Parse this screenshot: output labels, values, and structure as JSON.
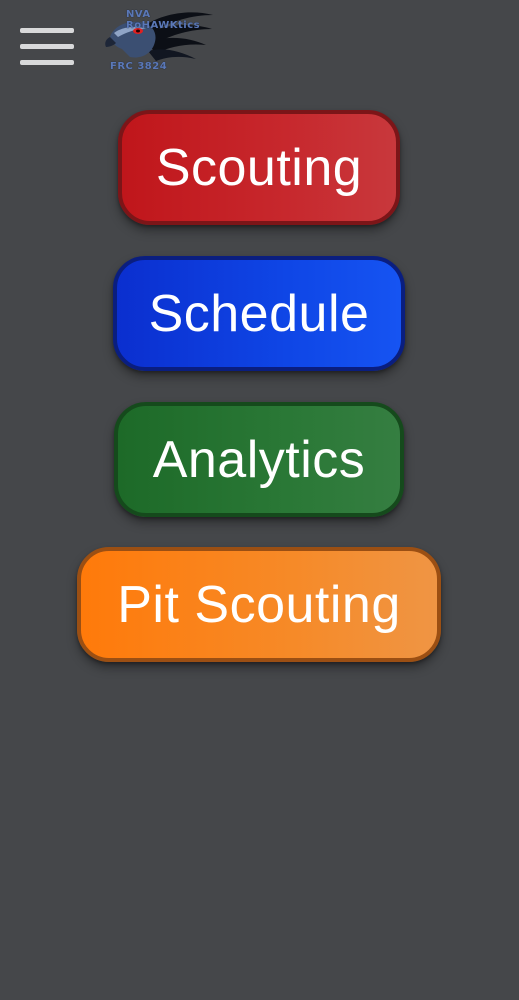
{
  "header": {
    "menu_icon": "hamburger-menu-icon",
    "logo": {
      "team_name": "NVA RoHAWKtics",
      "team_number": "FRC 3824",
      "icon": "hawk-logo-icon"
    }
  },
  "menu": {
    "items": [
      {
        "label": "Scouting",
        "color": "#c7282d"
      },
      {
        "label": "Schedule",
        "color": "#0f46e6"
      },
      {
        "label": "Analytics",
        "color": "#2a7836"
      },
      {
        "label": "Pit Scouting",
        "color": "#f68a28"
      }
    ]
  },
  "colors": {
    "background": "#45474a"
  }
}
